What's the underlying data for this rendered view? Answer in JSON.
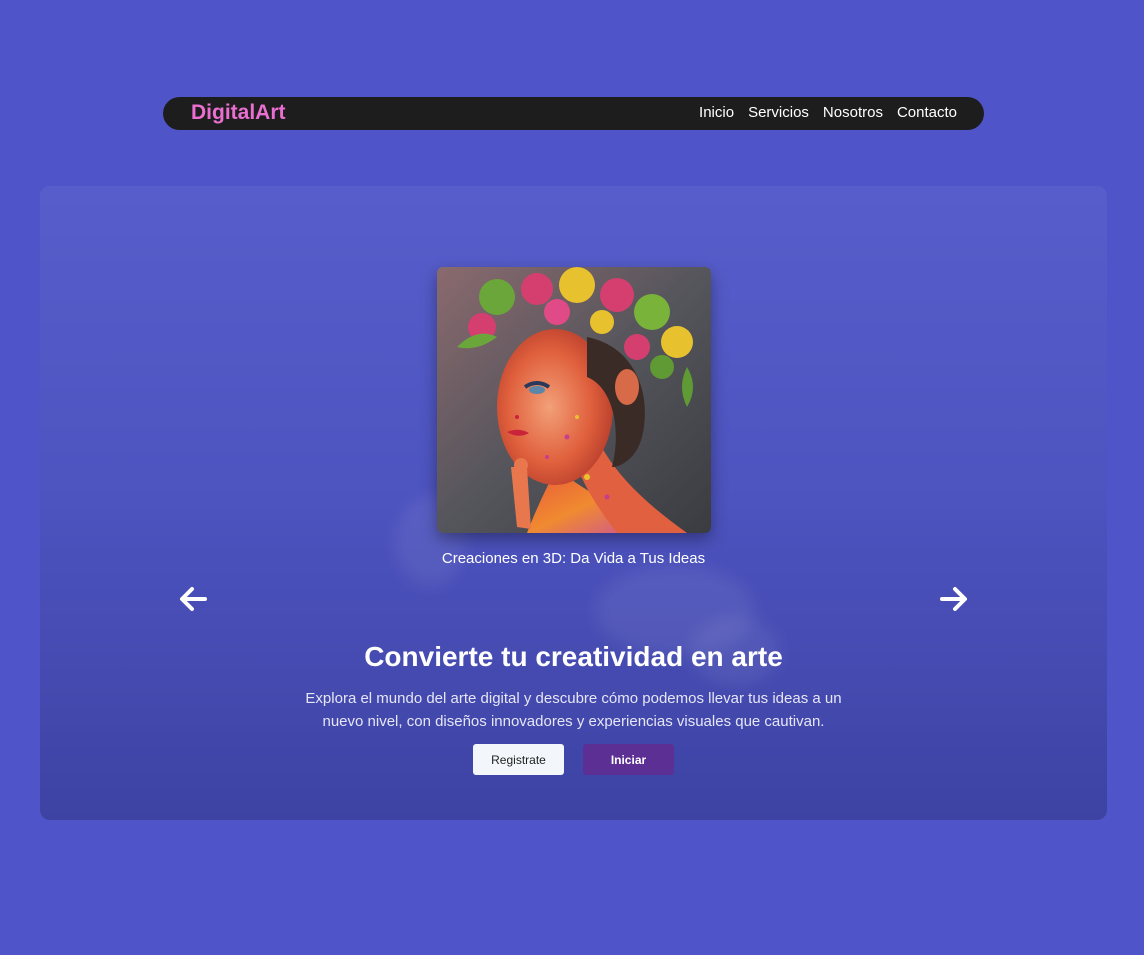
{
  "navbar": {
    "brand": "DigitalArt",
    "links": [
      {
        "label": "Inicio"
      },
      {
        "label": "Servicios"
      },
      {
        "label": "Nosotros"
      },
      {
        "label": "Contacto"
      }
    ]
  },
  "carousel": {
    "caption": "Creaciones en 3D: Da Vida a Tus Ideas",
    "prev_icon": "arrow-left-icon",
    "next_icon": "arrow-right-icon"
  },
  "hero": {
    "title": "Convierte tu creatividad en arte",
    "text": "Explora el mundo del arte digital y descubre cómo podemos llevar tus ideas a un nuevo nivel, con diseños innovadores y experiencias visuales que cautivan.",
    "register_label": "Registrate",
    "start_label": "Iniciar"
  },
  "colors": {
    "background": "#4f55c9",
    "navbar": "#1d1d1d",
    "brand": "#ea6fd1",
    "start_button": "#5c2f94",
    "register_button": "#f3f6fb"
  }
}
